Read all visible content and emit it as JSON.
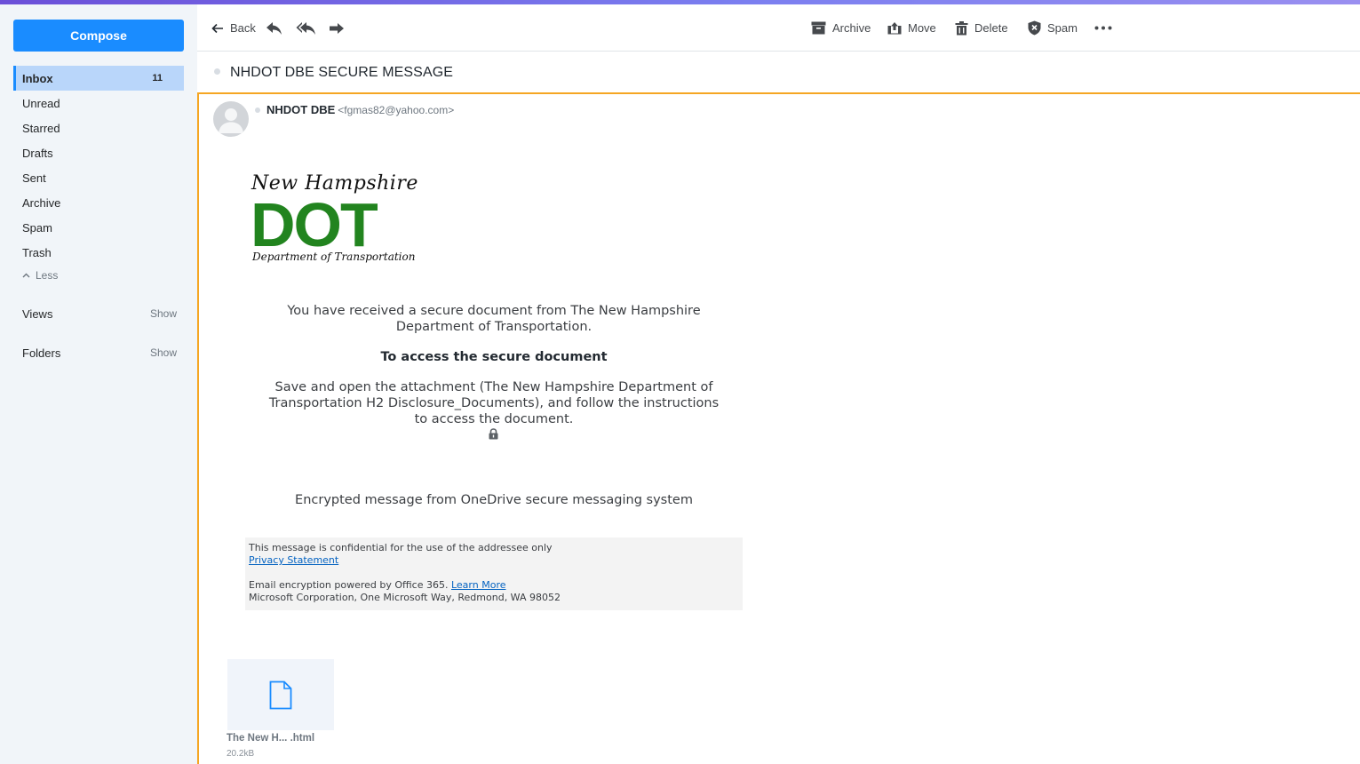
{
  "sidebar": {
    "compose_label": "Compose",
    "items": [
      {
        "label": "Inbox",
        "count": "11"
      },
      {
        "label": "Unread"
      },
      {
        "label": "Starred"
      },
      {
        "label": "Drafts"
      },
      {
        "label": "Sent"
      },
      {
        "label": "Archive"
      },
      {
        "label": "Spam"
      },
      {
        "label": "Trash"
      }
    ],
    "less_label": "Less",
    "views_label": "Views",
    "views_show": "Show",
    "folders_label": "Folders",
    "folders_show": "Show"
  },
  "toolbar": {
    "back_label": "Back",
    "archive_label": "Archive",
    "move_label": "Move",
    "delete_label": "Delete",
    "spam_label": "Spam"
  },
  "message": {
    "subject": "NHDOT DBE SECURE MESSAGE",
    "from_name": "NHDOT DBE",
    "from_email": "<fgmas82@yahoo.com>",
    "logo_script": "New Hampshire",
    "logo_big": "DOT",
    "logo_dept": "Department of Transportation",
    "line1": "You have received a secure document from The New Hampshire Department of Transportation.",
    "heading": "To access the secure document",
    "line2": "Save and open the attachment (The New Hampshire Department of Transportation H2 Disclosure_Documents), and follow the instructions to access the document.",
    "encrypted_line": "Encrypted message from OneDrive secure messaging system",
    "footer_confidential": "This message is confidential for the use of the addressee only",
    "footer_privacy": "Privacy Statement",
    "footer_powered": "Email encryption powered by Office 365.",
    "footer_learn_more": "Learn More",
    "footer_address": "Microsoft Corporation, One Microsoft Way, Redmond, WA 98052"
  },
  "attachment": {
    "name": "The New H... .html",
    "size": "20.2kB"
  },
  "colors": {
    "accent": "#1a8cff",
    "active_nav": "#b9d6fa",
    "selection_border": "#f5a623",
    "logo_green": "#22841f"
  }
}
